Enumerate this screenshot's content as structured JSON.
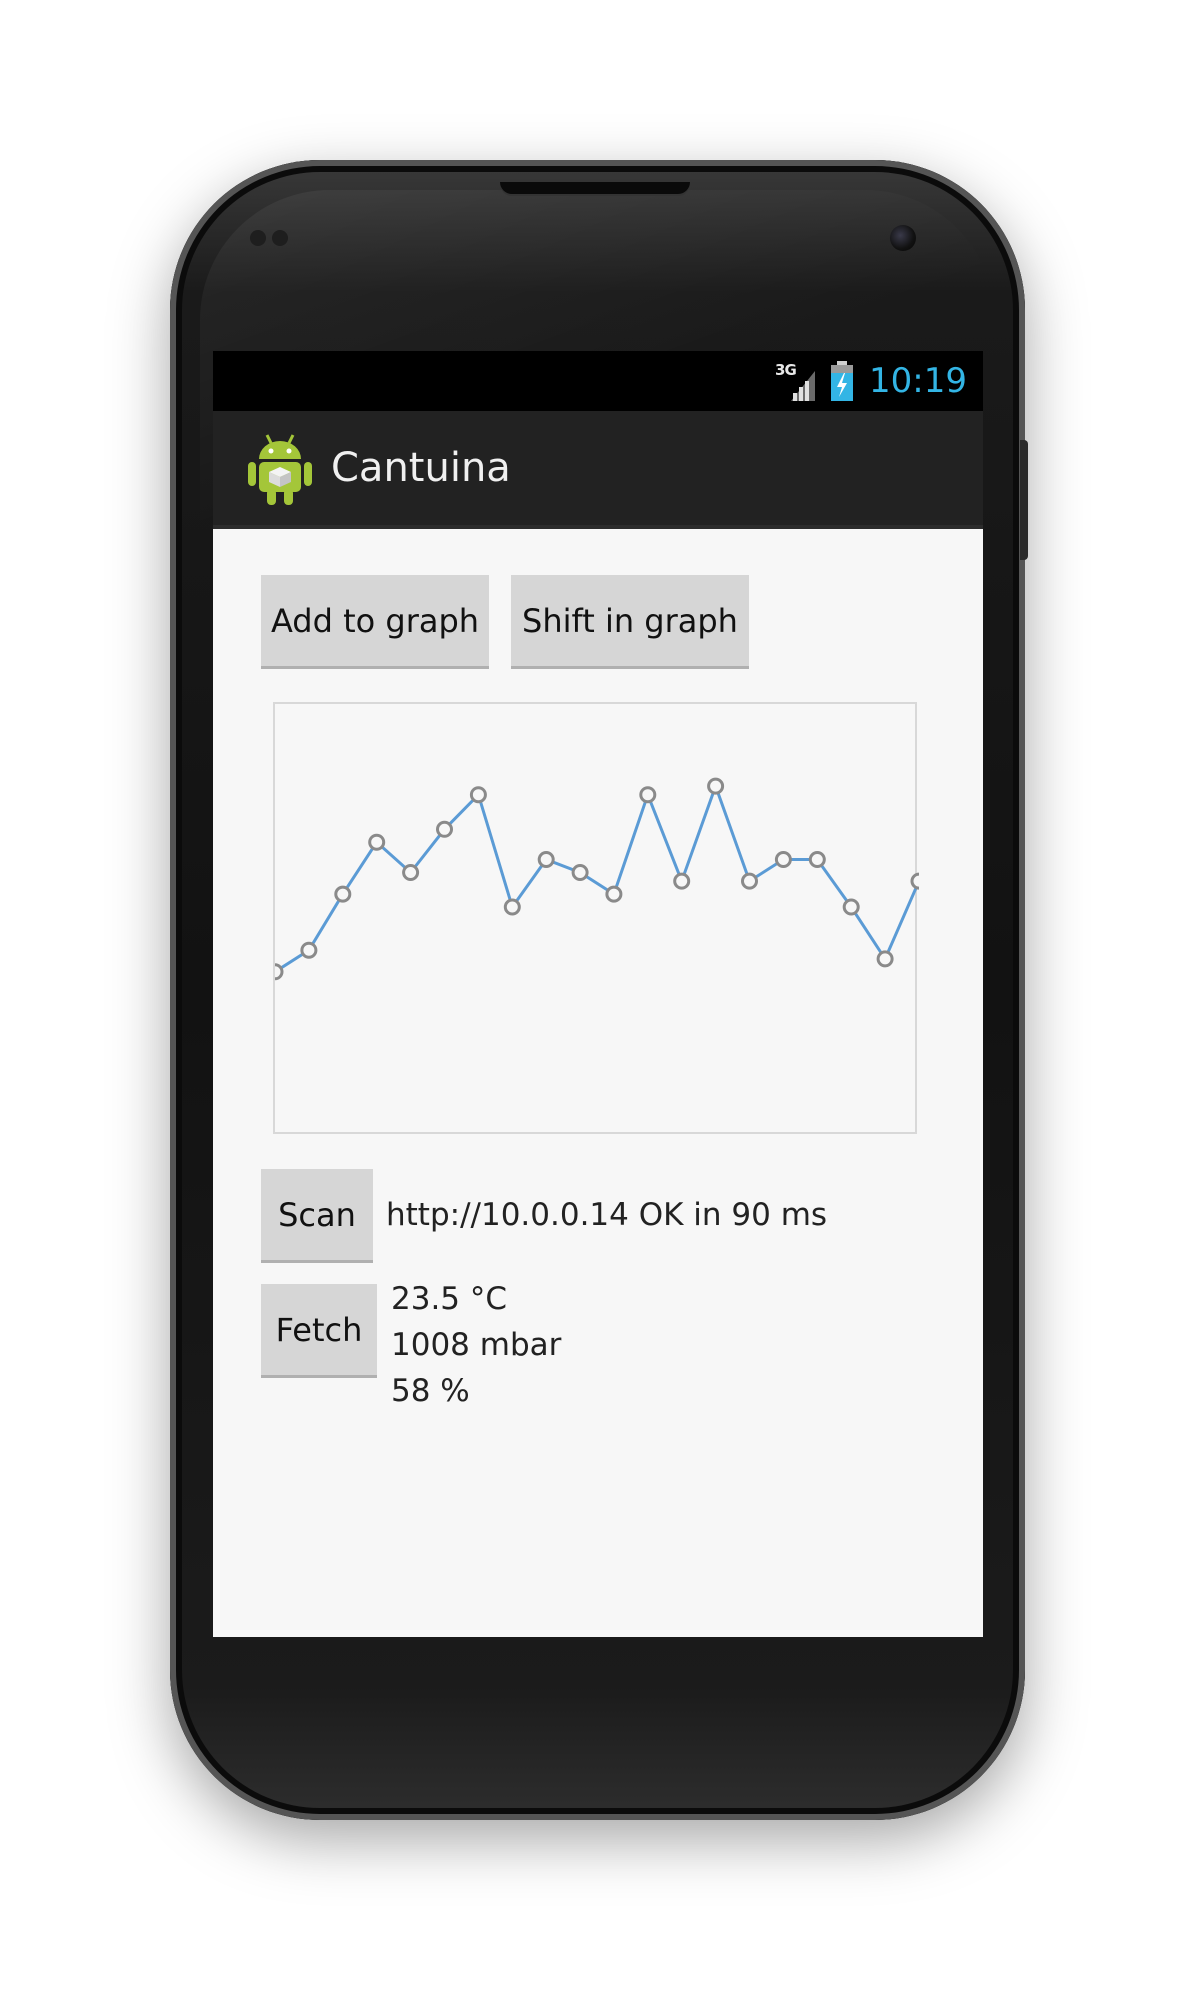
{
  "status_bar": {
    "network_label": "3G",
    "signal_icon": "signal-bars-icon",
    "battery_icon": "battery-charging-icon",
    "clock": "10:19",
    "clock_color": "#33b5e5"
  },
  "action_bar": {
    "app_icon": "android-robot-icon",
    "title": "Cantuina"
  },
  "toolbar": {
    "add_label": "Add to graph",
    "shift_label": "Shift in graph"
  },
  "scan": {
    "button_label": "Scan",
    "status": "http://10.0.0.14 OK in 90 ms"
  },
  "fetch": {
    "button_label": "Fetch",
    "temperature": "23.5 °C",
    "pressure": "1008 mbar",
    "humidity": "58 %"
  },
  "chart_data": {
    "type": "line",
    "x": [
      1,
      2,
      3,
      4,
      5,
      6,
      7,
      8,
      9,
      10,
      11,
      12,
      13,
      14,
      15,
      16,
      17,
      18,
      19,
      20
    ],
    "values": [
      0.38,
      0.43,
      0.56,
      0.68,
      0.61,
      0.71,
      0.79,
      0.53,
      0.64,
      0.61,
      0.56,
      0.79,
      0.59,
      0.81,
      0.59,
      0.64,
      0.64,
      0.53,
      0.41,
      0.59
    ],
    "ylim": [
      0,
      1
    ],
    "line_color": "#5b9bd5",
    "marker_color": "#8a8a8a",
    "grid": false
  }
}
